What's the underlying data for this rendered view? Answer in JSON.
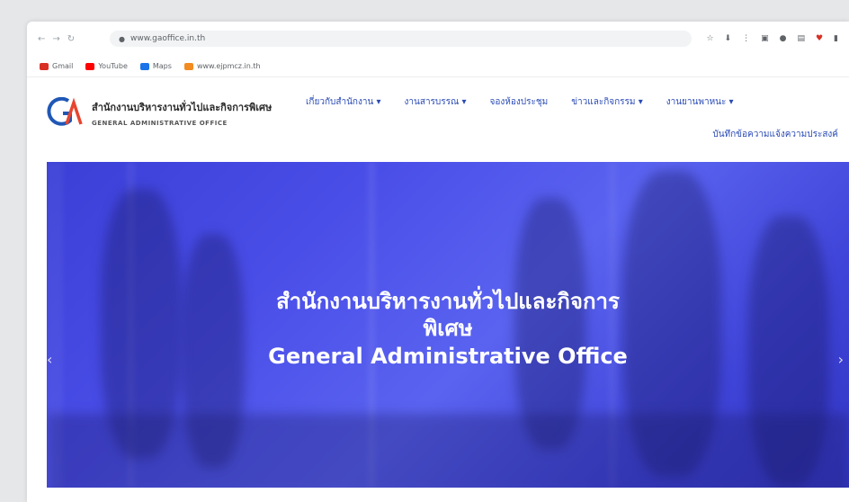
{
  "browser": {
    "url": "www.gaoffice.in.th",
    "nav": [
      "←",
      "→",
      "↻"
    ],
    "toolbar_icons": [
      "☆",
      "⬇",
      "⋮",
      "▣",
      "●",
      "▤",
      "♥",
      "▮"
    ]
  },
  "bookmarks": [
    {
      "label": "Gmail",
      "color": "#d93025"
    },
    {
      "label": "YouTube",
      "color": "#ff0000"
    },
    {
      "label": "Maps",
      "color": "#1a73e8"
    },
    {
      "label": "www.ejpmcz.in.th",
      "color": "#f28b20"
    }
  ],
  "site": {
    "logo_th": "สำนักงานบริหารงานทั่วไปและกิจการพิเศษ",
    "logo_en": "GENERAL ADMINISTRATIVE OFFICE",
    "logo_colors": {
      "primary": "#1f57b5",
      "accent": "#e8442e"
    },
    "menu": [
      "เกี่ยวกับสำนักงาน ▾",
      "งานสารบรรณ ▾",
      "จองห้องประชุม",
      "ข่าวและกิจกรรม ▾",
      "งานยานพาหนะ ▾"
    ],
    "menu_second_row": "บันทึกข้อความแจ้งความประสงค์"
  },
  "hero": {
    "title_th_line1": "สำนักงานบริหารงานทั่วไปและกิจการ",
    "title_th_line2": "พิเศษ",
    "title_en": "General Administrative Office",
    "prev": "‹",
    "next": "›",
    "color": "#4a4ee8"
  }
}
